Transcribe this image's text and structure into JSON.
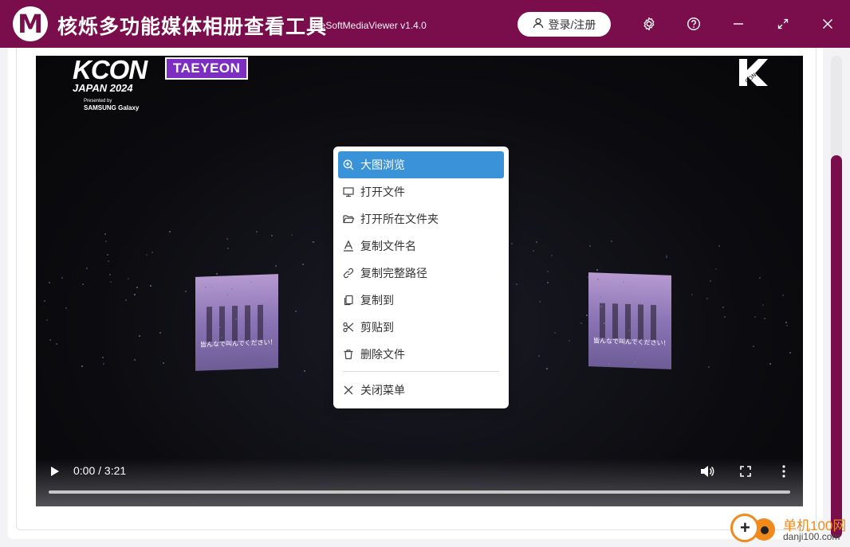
{
  "app": {
    "logo_letter": "M",
    "title": "核烁多功能媒体相册查看工具",
    "version": "HeSoftMediaViewer v1.4.0",
    "login_label": "登录/注册",
    "brand_color": "#7a0e4c"
  },
  "window_controls": [
    "gear-icon",
    "help-icon",
    "minimize-icon",
    "maximize-icon",
    "close-icon"
  ],
  "video": {
    "logo_text": "KCON",
    "logo_sub": "JAPAN 2024",
    "presented_by": "Presented by",
    "sponsor": "SAMSUNG Galaxy",
    "artist": "TAEYEON",
    "screen_caption": "皆んなで叫んでください！",
    "time": "0:00 / 3:21",
    "progress": 0.0
  },
  "context_menu": {
    "items": [
      {
        "label": "大图浏览",
        "icon": "zoom-in-icon",
        "active": true
      },
      {
        "label": "打开文件",
        "icon": "monitor-icon",
        "active": false
      },
      {
        "label": "打开所在文件夹",
        "icon": "folder-open-icon",
        "active": false
      },
      {
        "label": "复制文件名",
        "icon": "text-icon",
        "active": false
      },
      {
        "label": "复制完整路径",
        "icon": "link-icon",
        "active": false
      },
      {
        "label": "复制到",
        "icon": "copy-icon",
        "active": false
      },
      {
        "label": "剪贴到",
        "icon": "scissors-icon",
        "active": false
      },
      {
        "label": "删除文件",
        "icon": "trash-icon",
        "active": false
      }
    ],
    "close_label": "关闭菜单",
    "accent": "#3a93d9"
  },
  "watermark": {
    "line1": "单机100网",
    "line2": "danji100.com"
  }
}
